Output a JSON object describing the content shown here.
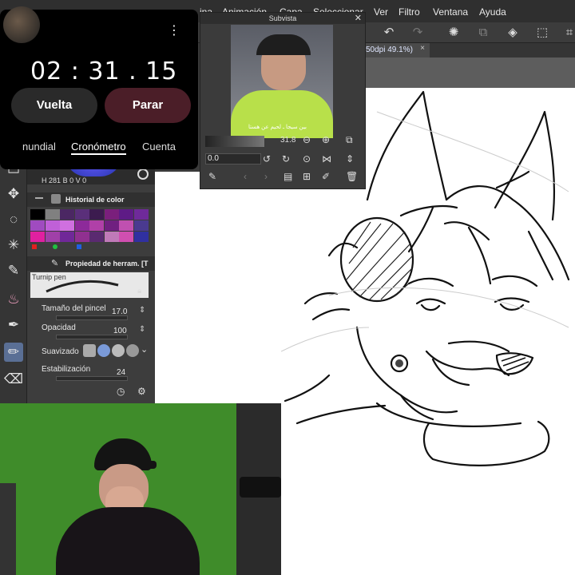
{
  "menubar": {
    "items": [
      "ina",
      "Animación",
      "Capa",
      "Seleccionar",
      "Ver",
      "Filtro",
      "Ventana",
      "Ayuda"
    ]
  },
  "canvas_tab": {
    "label": "50dpi 49.1%)",
    "close": "×"
  },
  "stopwatch": {
    "time": "02 : 31 . 15",
    "lap_label": "Vuelta",
    "stop_label": "Parar",
    "more": "⋮",
    "tabs": [
      "nundial",
      "Cronómetro",
      "Cuenta"
    ],
    "active_tab": "Cronómetro",
    "colors": {
      "lap_bg": "#2a2a2a",
      "stop_bg": "#4b1e28"
    }
  },
  "subview": {
    "title": "Subvista",
    "zoom": "31.8",
    "rotation": "0.0",
    "caption": "بين سيجا ـ لحيم عن هستا"
  },
  "color_panel": {
    "title": "Historial de color",
    "readout": {
      "h": "H",
      "v1": "281",
      "b": "B",
      "v2": "0",
      "v3": "V",
      "v4": "0"
    }
  },
  "tool_property": {
    "title": "Propiedad de herram. [T",
    "brush_name": "Turnip pen",
    "brush_size_label": "Tamaño del pincel",
    "brush_size_value": "17.0",
    "opacity_label": "Opacidad",
    "opacity_value": "100",
    "smoothing_label": "Suavizado",
    "stabilization_label": "Estabilización",
    "stabilization_value": "24"
  },
  "swatches": [
    "#000000",
    "#808080",
    "#4b2763",
    "#5a2f7a",
    "#3c1b4f",
    "#7a1f7c",
    "#5e1b86",
    "#6f2a9a",
    "#a04bc0",
    "#c060d8",
    "#d070e0",
    "#8d2a9a",
    "#b040a8",
    "#702080",
    "#c050b0",
    "#4a3a90",
    "#e020a0",
    "#a040a8",
    "#702898",
    "#903090",
    "#5a2a70",
    "#c07ab8",
    "#d04fb0",
    "#3030a0"
  ]
}
